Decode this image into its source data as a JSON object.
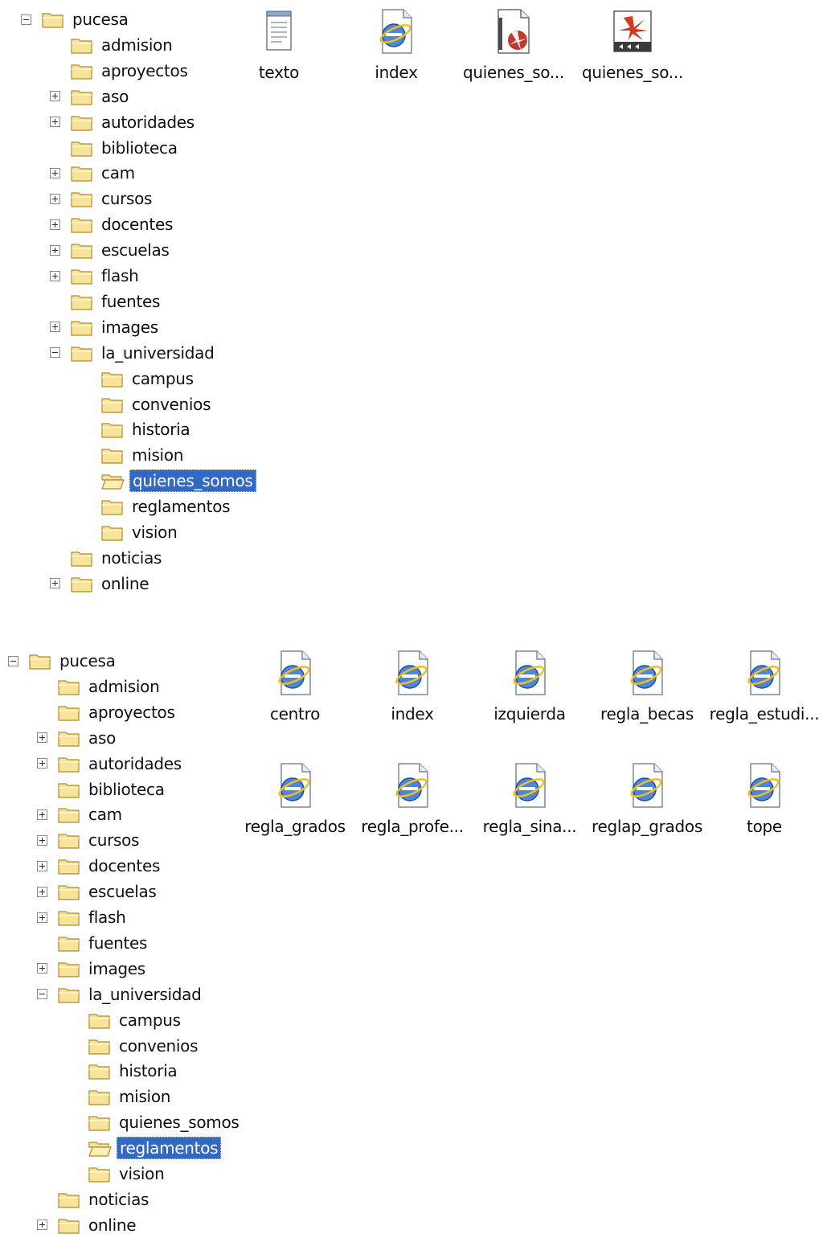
{
  "top_panel": {
    "tree": [
      {
        "label": "pucesa",
        "expander": "minus",
        "level": 0
      },
      {
        "label": "admision",
        "expander": "none",
        "level": 1
      },
      {
        "label": "aproyectos",
        "expander": "none",
        "level": 1
      },
      {
        "label": "aso",
        "expander": "plus",
        "level": 1
      },
      {
        "label": "autoridades",
        "expander": "plus",
        "level": 1
      },
      {
        "label": "biblioteca",
        "expander": "none",
        "level": 1
      },
      {
        "label": "cam",
        "expander": "plus",
        "level": 1
      },
      {
        "label": "cursos",
        "expander": "plus",
        "level": 1
      },
      {
        "label": "docentes",
        "expander": "plus",
        "level": 1
      },
      {
        "label": "escuelas",
        "expander": "plus",
        "level": 1
      },
      {
        "label": "flash",
        "expander": "plus",
        "level": 1
      },
      {
        "label": "fuentes",
        "expander": "none",
        "level": 1
      },
      {
        "label": "images",
        "expander": "plus",
        "level": 1
      },
      {
        "label": "la_universidad",
        "expander": "minus",
        "level": 1
      },
      {
        "label": "campus",
        "expander": "none",
        "level": 2
      },
      {
        "label": "convenios",
        "expander": "none",
        "level": 2
      },
      {
        "label": "historia",
        "expander": "none",
        "level": 2
      },
      {
        "label": "mision",
        "expander": "none",
        "level": 2
      },
      {
        "label": "quienes_somos",
        "expander": "none",
        "level": 2,
        "selected": true,
        "open": true
      },
      {
        "label": "reglamentos",
        "expander": "none",
        "level": 2
      },
      {
        "label": "vision",
        "expander": "none",
        "level": 2
      },
      {
        "label": "noticias",
        "expander": "none",
        "level": 1
      },
      {
        "label": "online",
        "expander": "plus",
        "level": 1
      }
    ],
    "files": [
      {
        "name": "texto",
        "icon": "notepad-text-icon"
      },
      {
        "name": "index",
        "icon": "ie-document-icon"
      },
      {
        "name": "quienes_so...",
        "icon": "flash-document-icon"
      },
      {
        "name": "quienes_so...",
        "icon": "swf-movie-icon"
      }
    ]
  },
  "bottom_panel": {
    "tree": [
      {
        "label": "pucesa",
        "expander": "minus",
        "level": 0
      },
      {
        "label": "admision",
        "expander": "none",
        "level": 1
      },
      {
        "label": "aproyectos",
        "expander": "none",
        "level": 1
      },
      {
        "label": "aso",
        "expander": "plus",
        "level": 1
      },
      {
        "label": "autoridades",
        "expander": "plus",
        "level": 1
      },
      {
        "label": "biblioteca",
        "expander": "none",
        "level": 1
      },
      {
        "label": "cam",
        "expander": "plus",
        "level": 1
      },
      {
        "label": "cursos",
        "expander": "plus",
        "level": 1
      },
      {
        "label": "docentes",
        "expander": "plus",
        "level": 1
      },
      {
        "label": "escuelas",
        "expander": "plus",
        "level": 1
      },
      {
        "label": "flash",
        "expander": "plus",
        "level": 1
      },
      {
        "label": "fuentes",
        "expander": "none",
        "level": 1
      },
      {
        "label": "images",
        "expander": "plus",
        "level": 1
      },
      {
        "label": "la_universidad",
        "expander": "minus",
        "level": 1
      },
      {
        "label": "campus",
        "expander": "none",
        "level": 2
      },
      {
        "label": "convenios",
        "expander": "none",
        "level": 2
      },
      {
        "label": "historia",
        "expander": "none",
        "level": 2
      },
      {
        "label": "mision",
        "expander": "none",
        "level": 2
      },
      {
        "label": "quienes_somos",
        "expander": "none",
        "level": 2
      },
      {
        "label": "reglamentos",
        "expander": "none",
        "level": 2,
        "selected": true,
        "open": true
      },
      {
        "label": "vision",
        "expander": "none",
        "level": 2
      },
      {
        "label": "noticias",
        "expander": "none",
        "level": 1
      },
      {
        "label": "online",
        "expander": "plus",
        "level": 1
      }
    ],
    "files": [
      {
        "name": "centro",
        "icon": "ie-document-icon"
      },
      {
        "name": "index",
        "icon": "ie-document-icon"
      },
      {
        "name": "izquierda",
        "icon": "ie-document-icon"
      },
      {
        "name": "regla_becas",
        "icon": "ie-document-icon"
      },
      {
        "name": "regla_estudi...",
        "icon": "ie-document-icon"
      },
      {
        "name": "regla_grados",
        "icon": "ie-document-icon"
      },
      {
        "name": "regla_profe...",
        "icon": "ie-document-icon"
      },
      {
        "name": "regla_sina...",
        "icon": "ie-document-icon"
      },
      {
        "name": "reglap_grados",
        "icon": "ie-document-icon"
      },
      {
        "name": "tope",
        "icon": "ie-document-icon"
      }
    ]
  },
  "colors": {
    "selection": "#316ac5",
    "folder_fill": "#f7e39a",
    "folder_stroke": "#b08a2a"
  }
}
